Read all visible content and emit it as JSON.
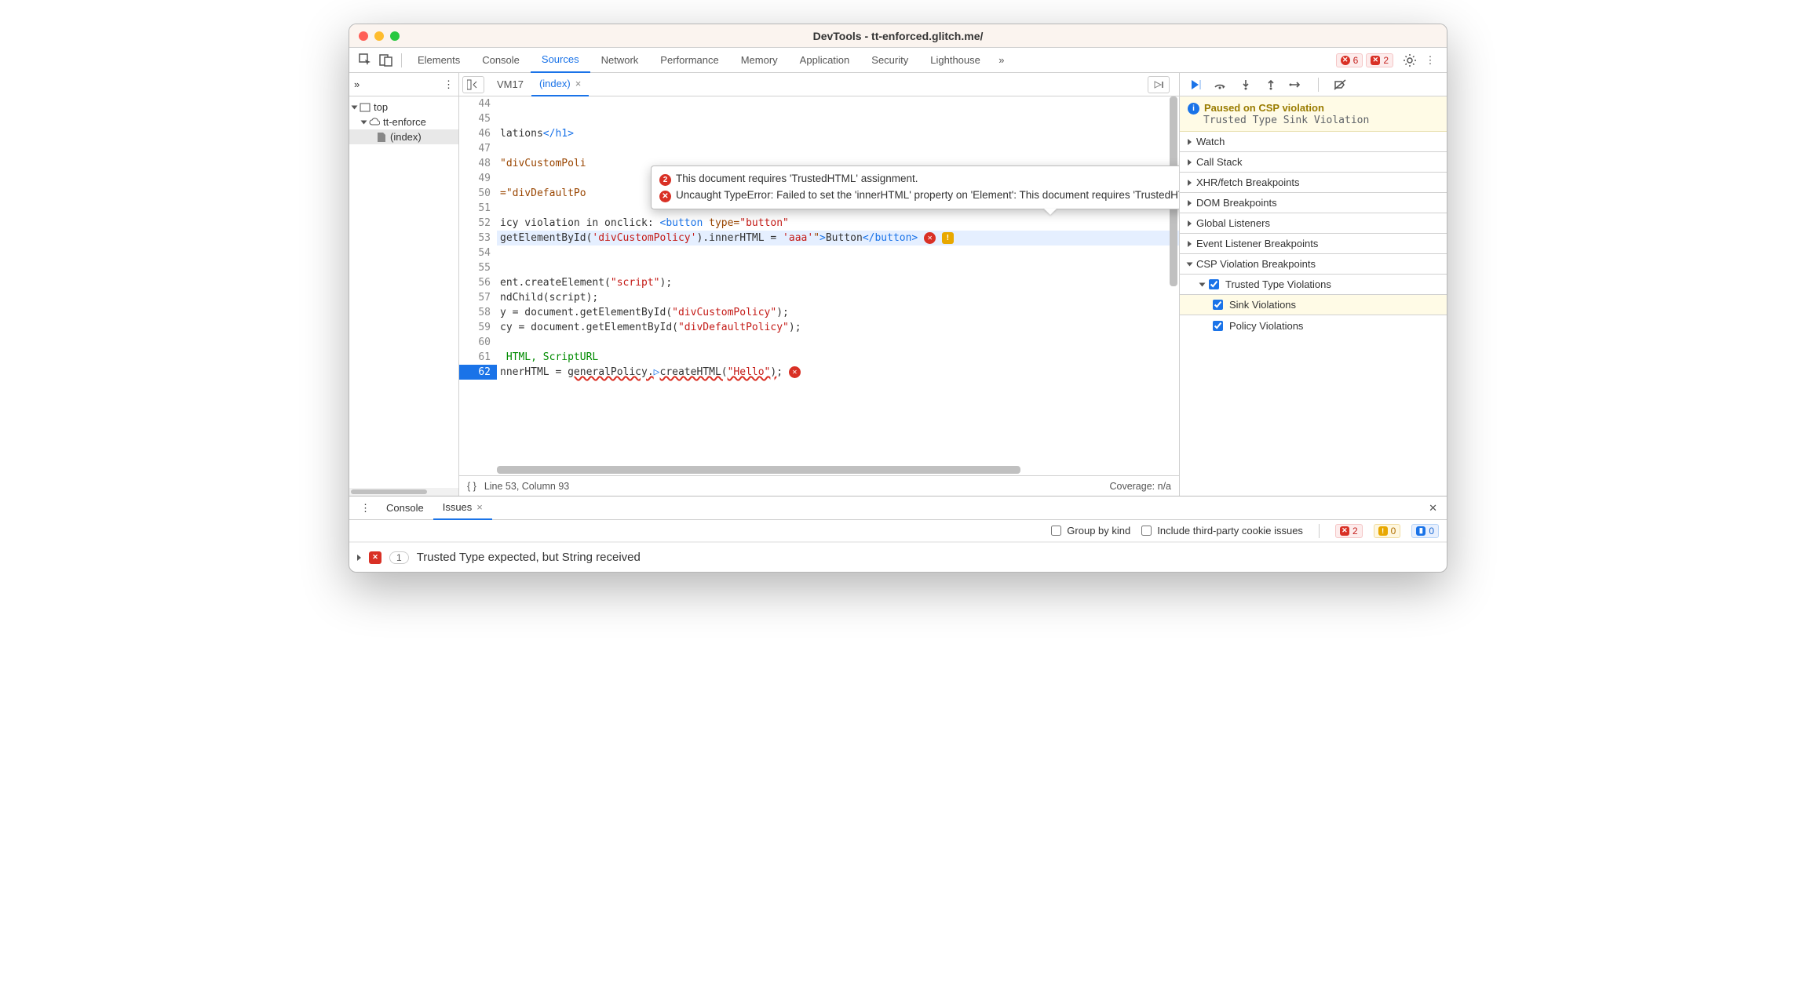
{
  "window": {
    "title": "DevTools - tt-enforced.glitch.me/"
  },
  "main_tabs": {
    "items": [
      "Elements",
      "Console",
      "Sources",
      "Network",
      "Performance",
      "Memory",
      "Application",
      "Security",
      "Lighthouse"
    ],
    "active": "Sources",
    "error_count": "6",
    "error2_count": "2"
  },
  "left": {
    "top": "top",
    "origin": "tt-enforce",
    "file": "(index)"
  },
  "center": {
    "tab_vm": "VM17",
    "tab_index": "(index)",
    "cursor": "Line 53, Column 93",
    "coverage": "Coverage: n/a",
    "lines": {
      "44": "",
      "45": "",
      "46": "lations</h1>",
      "47": "",
      "48": "\"divCustomPoli",
      "49": "",
      "50": "=\"divDefaultPo",
      "51": "",
      "52": "icy violation in onclick: <button type=\"button\"",
      "53": "getElementById('divCustomPolicy').innerHTML = 'aaa'\">Button</button>",
      "54": "",
      "55": "",
      "56": "ent.createElement(\"script\");",
      "57": "ndChild(script);",
      "58": "y = document.getElementById(\"divCustomPolicy\");",
      "59": "cy = document.getElementById(\"divDefaultPolicy\");",
      "60": "",
      "61": " HTML, ScriptURL",
      "62": "nnerHTML = generalPolicy.createHTML(\"Hello\");"
    }
  },
  "tooltip": {
    "count": "2",
    "msg1": "This document requires 'TrustedHTML' assignment.",
    "msg2": "Uncaught TypeError: Failed to set the 'innerHTML' property on 'Element': This document requires 'TrustedHTML' assignment."
  },
  "right": {
    "paused_title": "Paused on CSP violation",
    "paused_sub": "Trusted Type Sink Violation",
    "sections": {
      "watch": "Watch",
      "callstack": "Call Stack",
      "xhr": "XHR/fetch Breakpoints",
      "dom": "DOM Breakpoints",
      "global": "Global Listeners",
      "event": "Event Listener Breakpoints",
      "csp": "CSP Violation Breakpoints",
      "tt": "Trusted Type Violations",
      "sink": "Sink Violations",
      "policy": "Policy Violations"
    }
  },
  "drawer": {
    "console": "Console",
    "issues": "Issues",
    "group": "Group by kind",
    "third": "Include third-party cookie issues",
    "count_err": "2",
    "count_warn": "0",
    "count_info": "0",
    "issue1": "Trusted Type expected, but String received",
    "issue1_count": "1"
  }
}
